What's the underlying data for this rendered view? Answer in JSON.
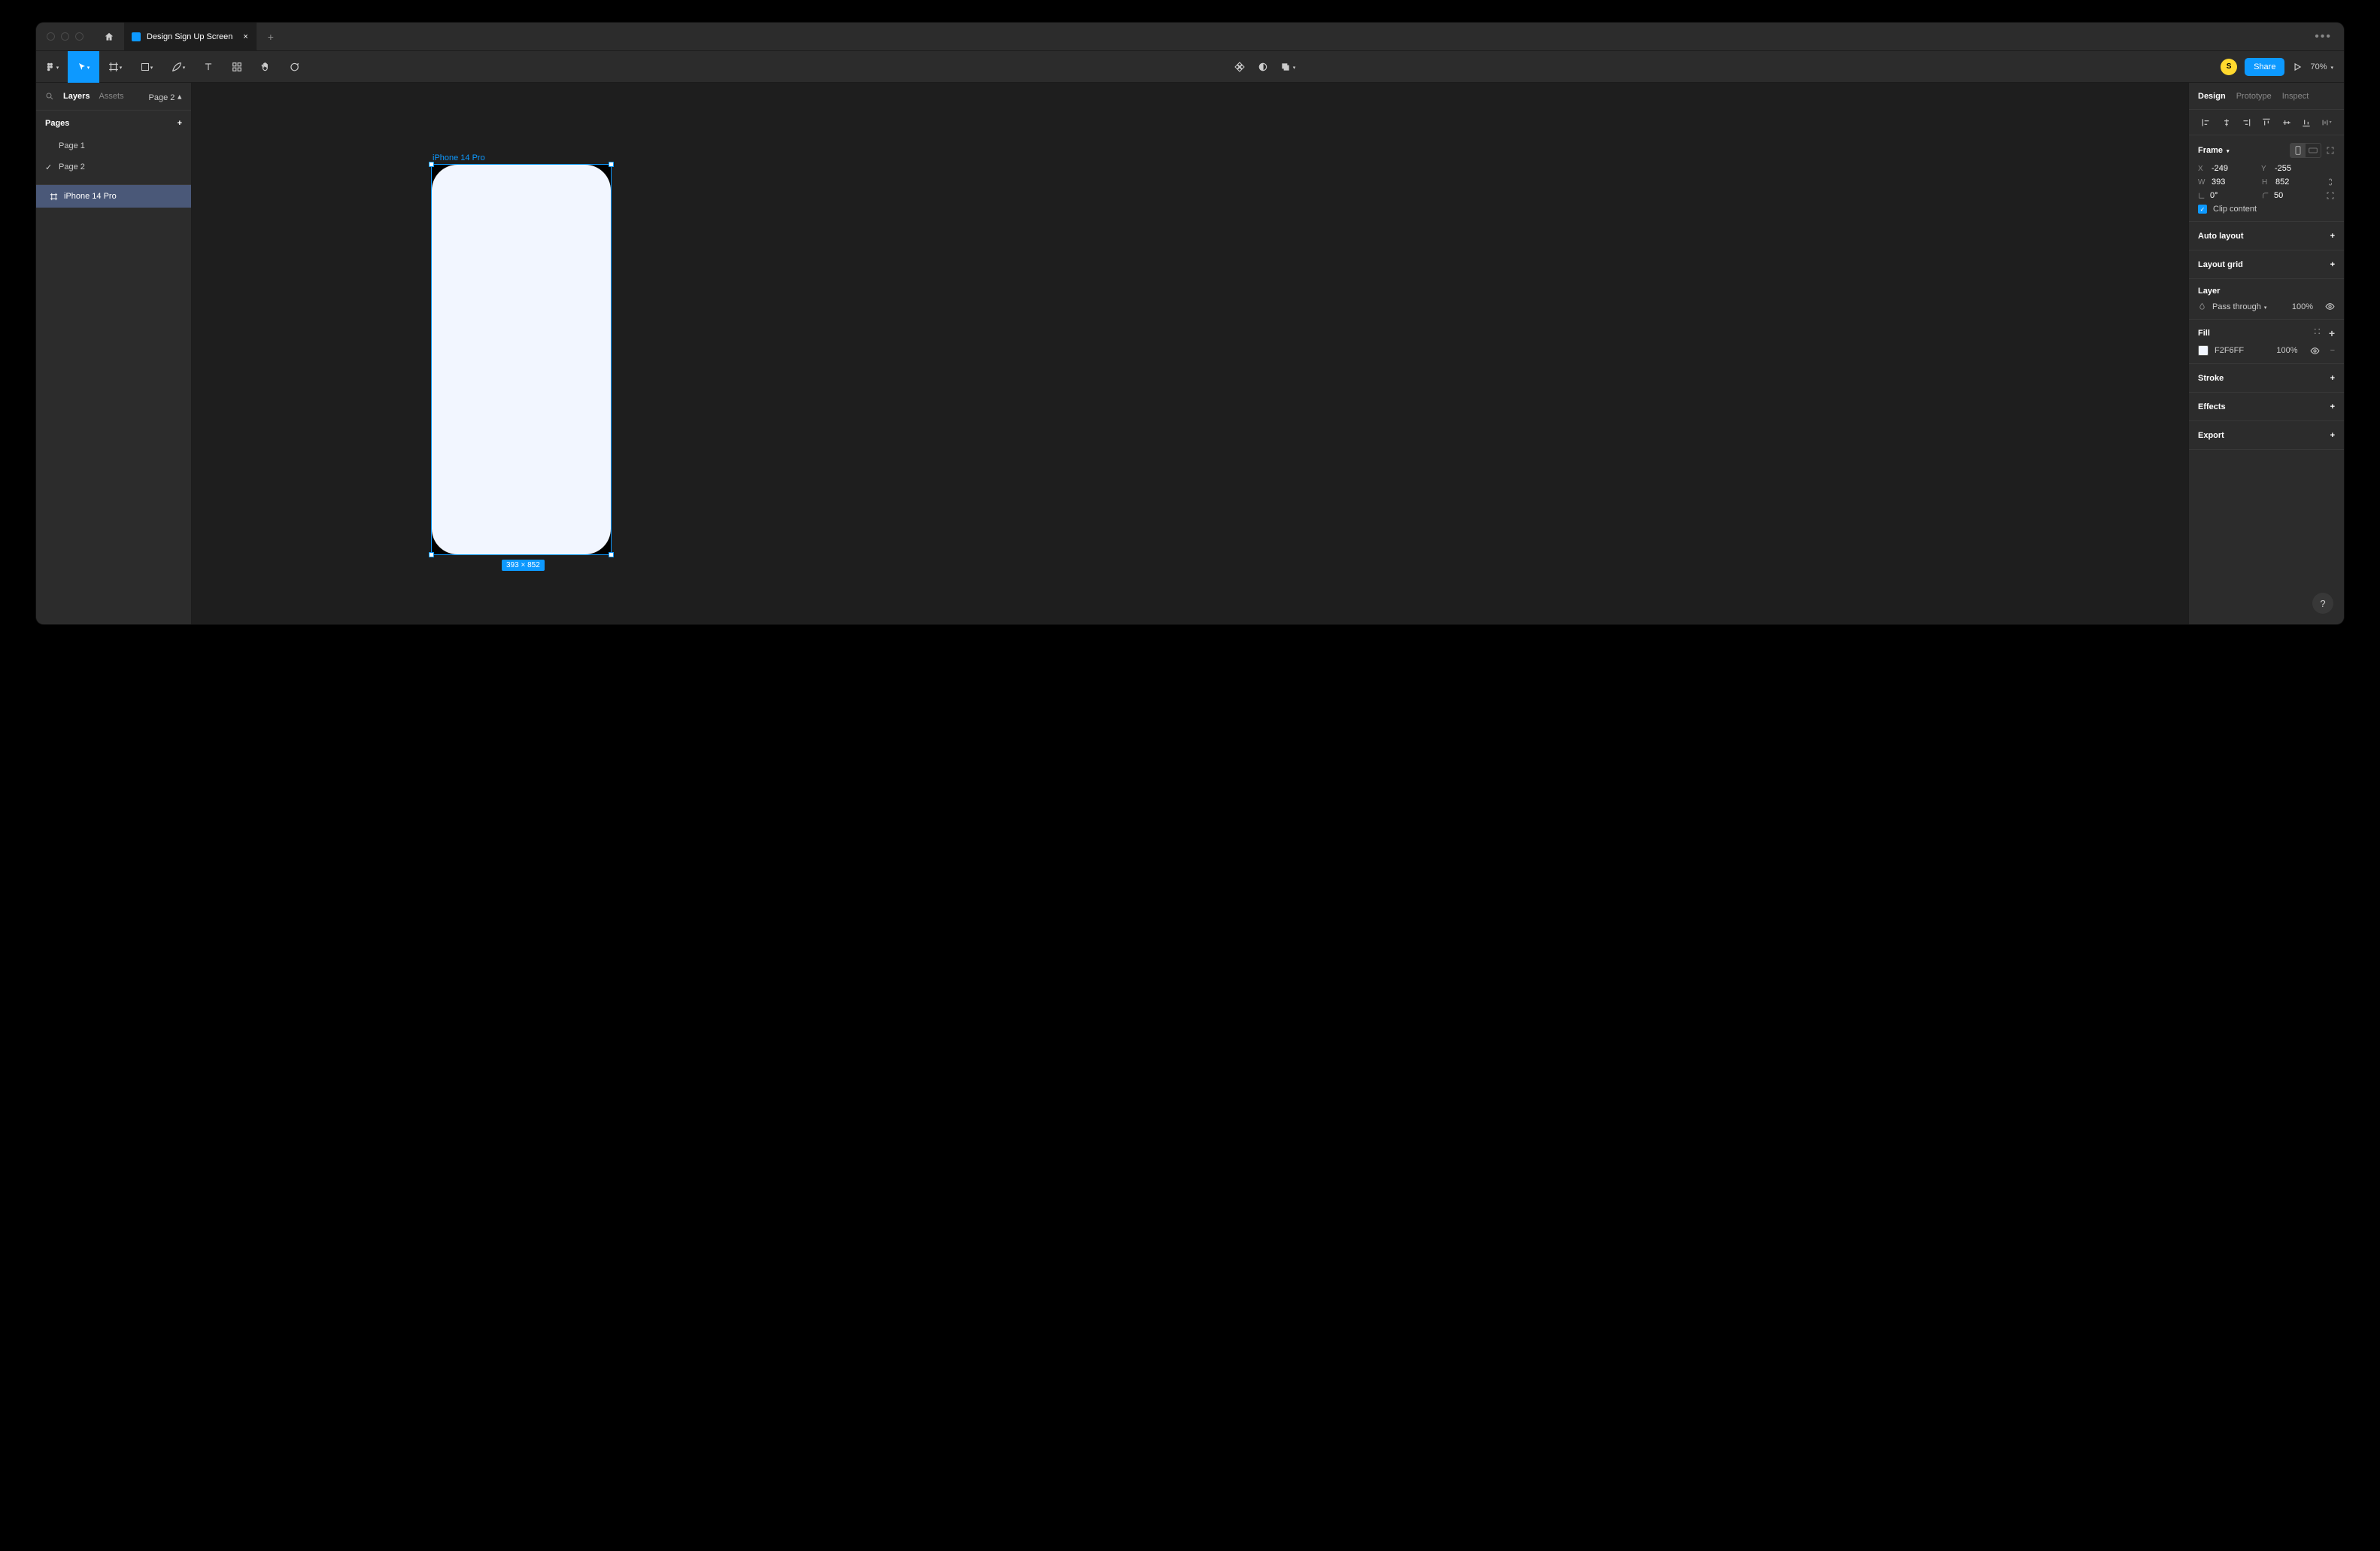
{
  "titlebar": {
    "file_name": "Design Sign Up Screen"
  },
  "toolbar": {
    "avatar_initial": "S",
    "share_label": "Share",
    "zoom": "70%"
  },
  "left_panel": {
    "tabs": {
      "layers": "Layers",
      "assets": "Assets"
    },
    "page_selector": "Page 2",
    "pages_header": "Pages",
    "pages": [
      "Page 1",
      "Page 2"
    ],
    "layers": [
      "iPhone 14 Pro"
    ]
  },
  "canvas": {
    "frame_label": "iPhone 14 Pro",
    "dimensions_badge": "393 × 852"
  },
  "right_panel": {
    "tabs": {
      "design": "Design",
      "prototype": "Prototype",
      "inspect": "Inspect"
    },
    "frame": {
      "header": "Frame",
      "x": "-249",
      "y": "-255",
      "w": "393",
      "h": "852",
      "rotation": "0°",
      "radius": "50",
      "clip_content": "Clip content"
    },
    "auto_layout": "Auto layout",
    "layout_grid": "Layout grid",
    "layer": {
      "header": "Layer",
      "blend_mode": "Pass through",
      "opacity": "100%"
    },
    "fill": {
      "header": "Fill",
      "hex": "F2F6FF",
      "opacity": "100%"
    },
    "stroke": "Stroke",
    "effects": "Effects",
    "export": "Export"
  }
}
